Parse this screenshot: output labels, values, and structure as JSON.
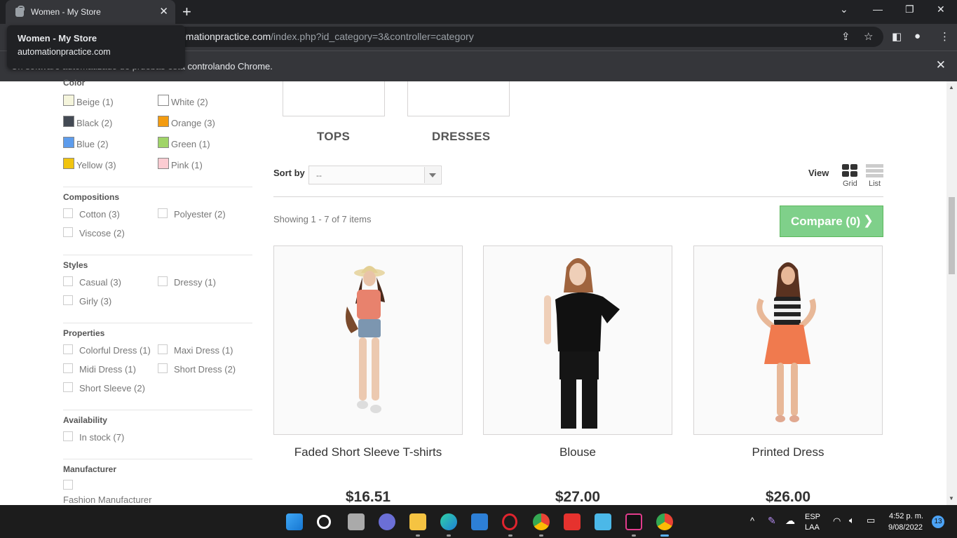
{
  "browser": {
    "tab_title": "Women - My Store",
    "url_host_partial": "omationpractice.com",
    "url_path": "/index.php?id_category=3&controller=category",
    "tooltip_title": "Women - My Store",
    "tooltip_host": "automationpractice.com",
    "infobar_message": "Un software automatizado de pruebas está controlando Chrome."
  },
  "sidebar": {
    "color": {
      "heading": "Color",
      "items": [
        {
          "label": "Beige (1)",
          "color": "#f5f5dc"
        },
        {
          "label": "White (2)",
          "color": "#ffffff"
        },
        {
          "label": "Black (2)",
          "color": "#434a54"
        },
        {
          "label": "Orange (3)",
          "color": "#f39c11"
        },
        {
          "label": "Blue (2)",
          "color": "#5d9cec"
        },
        {
          "label": "Green (1)",
          "color": "#a0d468"
        },
        {
          "label": "Yellow (3)",
          "color": "#f1c40f"
        },
        {
          "label": "Pink (1)",
          "color": "#fcccd2"
        }
      ]
    },
    "compositions": {
      "heading": "Compositions",
      "items": [
        "Cotton (3)",
        "Polyester (2)",
        "Viscose (2)"
      ]
    },
    "styles": {
      "heading": "Styles",
      "items": [
        "Casual (3)",
        "Dressy (1)",
        "Girly (3)"
      ]
    },
    "properties": {
      "heading": "Properties",
      "items": [
        "Colorful Dress (1)",
        "Maxi Dress (1)",
        "Midi Dress (1)",
        "Short Dress (2)",
        "Short Sleeve (2)"
      ]
    },
    "availability": {
      "heading": "Availability",
      "items": [
        "In stock (7)"
      ]
    },
    "manufacturer": {
      "heading": "Manufacturer",
      "items": [
        "Fashion Manufacturer"
      ]
    }
  },
  "subcategories": [
    "TOPS",
    "DRESSES"
  ],
  "toolbar": {
    "sort_label": "Sort by",
    "sort_value": "--",
    "view_label": "View",
    "grid_label": "Grid",
    "list_label": "List"
  },
  "listing": {
    "showing": "Showing 1 - 7 of 7 items",
    "compare": "Compare (0)"
  },
  "products": [
    {
      "name": "Faded Short Sleeve T-shirts",
      "price": "$16.51"
    },
    {
      "name": "Blouse",
      "price": "$27.00"
    },
    {
      "name": "Printed Dress",
      "price": "$26.00"
    }
  ],
  "taskbar": {
    "lang": "ESP",
    "layout": "LAA",
    "time": "4:52 p. m.",
    "date": "9/08/2022",
    "notifications": "13"
  }
}
